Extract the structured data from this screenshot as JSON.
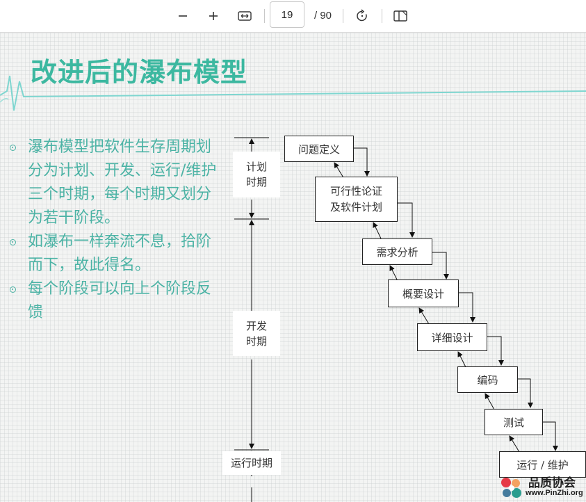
{
  "toolbar": {
    "page_number": "19",
    "page_total": "/ 90"
  },
  "slide": {
    "title": "改进后的瀑布模型",
    "bullets": [
      "瀑布模型把软件生存周期划分为计划、开发、运行/维护三个时期，每个时期又划分为若干阶段。",
      "如瀑布一样奔流不息，拾阶而下，故此得名。",
      "每个阶段可以向上个阶段反馈"
    ],
    "periods": [
      "计划时期",
      "开发时期",
      "运行时期"
    ],
    "stages": [
      "问题定义",
      "可行性论证及软件计划",
      "需求分析",
      "概要设计",
      "详细设计",
      "编码",
      "测试",
      "运行 / 维护"
    ],
    "period_plan_lines": [
      "计划",
      "时期"
    ],
    "period_dev_lines": [
      "开发",
      "时期"
    ],
    "stage_feasibility_lines": [
      "可行性论证",
      "及软件计划"
    ]
  },
  "watermark": {
    "name": "品质协会",
    "url": "www.PinZhi.org"
  },
  "colors": {
    "title": "#3cb8a0",
    "bullet_text": "#4cb3a5",
    "accent_line": "#7fd6d0"
  }
}
